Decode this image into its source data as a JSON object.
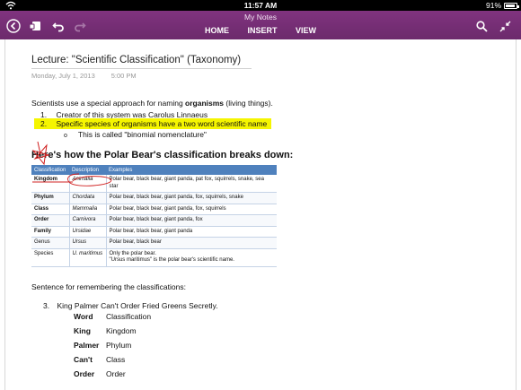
{
  "status_bar": {
    "time": "11:57 AM",
    "battery": "91%"
  },
  "header": {
    "title": "My Notes",
    "tabs": [
      {
        "label": "HOME"
      },
      {
        "label": "INSERT"
      },
      {
        "label": "VIEW"
      }
    ],
    "icons": [
      "back-arrow-icon",
      "notebooks-icon",
      "undo-icon",
      "redo-icon",
      "search-icon",
      "collapse-icon"
    ]
  },
  "note": {
    "title": "Lecture: \"Scientific Classification\" (Taxonomy)",
    "date": "Monday, July 1, 2013",
    "time": "5:00 PM",
    "intro_pre": "Scientists use a special approach for naming ",
    "intro_bold": "organisms",
    "intro_post": " (living things).",
    "item1_num": "1.",
    "item1_text": "Creator of this system was Carolus Linnaeus",
    "item2_num": "2.",
    "item2_text": "Specific species of organisms have a two word scientific name",
    "sub_bullet": "o",
    "sub_text": "This is called \"binomial nomenclature\"",
    "highlight_color": "#f5f500",
    "heading": "Here's how the Polar Bear's classification breaks down:",
    "table": {
      "header_color": "#4f81bd",
      "headers": [
        "Classification",
        "Description",
        "Examples"
      ],
      "rows": [
        {
          "c": "Kingdom",
          "d": "Animalia",
          "e": "Polar bear, black bear, giant panda, pat fox, squirrels, snake, sea star"
        },
        {
          "c": "Phylum",
          "d": "Chordata",
          "e": "Polar bear, black bear, giant panda, fox, squirrels, snake"
        },
        {
          "c": "Class",
          "d": "Mammalia",
          "e": "Polar bear, black bear, giant panda, fox, squirrels"
        },
        {
          "c": "Order",
          "d": "Carnivora",
          "e": "Polar bear, black bear, giant panda, fox"
        },
        {
          "c": "Family",
          "d": "Ursidae",
          "e": "Polar bear, black bear, giant panda"
        },
        {
          "c": "Genus",
          "d": "Ursus",
          "e": "Polar bear, black bear"
        },
        {
          "c": "Species",
          "d": "U. maritimus",
          "e": "Only the polar bear.",
          "e2": "\"Ursus maritimus\" is the polar bear's scientific name."
        }
      ]
    },
    "sentence": "Sentence for remembering the classifications:",
    "item3_num": "3.",
    "item3_text": "King Palmer Can't Order Fried Greens Secretly.",
    "mnemonic": [
      {
        "w": "Word",
        "c": "Classification"
      },
      {
        "w": "King",
        "c": "Kingdom"
      },
      {
        "w": "Palmer",
        "c": "Phylum"
      },
      {
        "w": "Can't",
        "c": "Class"
      },
      {
        "w": "Order",
        "c": "Order"
      }
    ],
    "ink_color": "#d02020"
  }
}
